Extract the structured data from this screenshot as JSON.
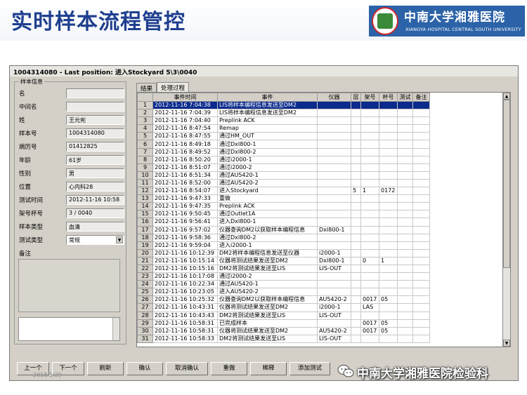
{
  "slide": {
    "title": "实时样本流程管控",
    "logo_cn": "中南大学湘雅医院",
    "logo_en": "XIANGYA HOSPITAL CENTRAL SOUTH UNIVERSITY"
  },
  "window": {
    "title": "1004314080 - Last position: 进入Stockyard  5\\3\\0040"
  },
  "sample_info": {
    "legend": "样本信息",
    "fields": [
      {
        "label": "名",
        "value": ""
      },
      {
        "label": "中间名",
        "value": ""
      },
      {
        "label": "姓",
        "value": "王元宪"
      },
      {
        "label": "样本号",
        "value": "1004314080"
      },
      {
        "label": "病历号",
        "value": "01412825"
      },
      {
        "label": "年龄",
        "value": "61岁"
      },
      {
        "label": "性别",
        "value": "男"
      },
      {
        "label": "位置",
        "value": "心内科28"
      },
      {
        "label": "测试时间",
        "value": "2012-11-16 10:58"
      },
      {
        "label": "架号杯号",
        "value": "3 / 0040"
      },
      {
        "label": "样本类型",
        "value": "血清"
      },
      {
        "label": "测试类型",
        "value": "常规"
      }
    ],
    "remark_label": "备注"
  },
  "tabs": [
    {
      "label": "结果",
      "active": false
    },
    {
      "label": "处理过程",
      "active": true
    }
  ],
  "grid": {
    "columns": [
      "",
      "事件时间",
      "事件",
      "仪器",
      "层",
      "架号",
      "杯号",
      "测试",
      "备注"
    ],
    "selected_row": 0,
    "rows": [
      [
        "1",
        "2012-11-16 7:04:38",
        "LIS将样本编程信息发送至DM2",
        "",
        "",
        "",
        "",
        "",
        ""
      ],
      [
        "2",
        "2012-11-16 7:04:39",
        "LIS将样本编程信息发送至DM2",
        "",
        "",
        "",
        "",
        "",
        ""
      ],
      [
        "3",
        "2012-11-16 7:04:40",
        "Preplink ACK",
        "",
        "",
        "",
        "",
        "",
        ""
      ],
      [
        "4",
        "2012-11-16 8:47:54",
        "Remap",
        "",
        "",
        "",
        "",
        "",
        ""
      ],
      [
        "5",
        "2012-11-16 8:47:55",
        "通过HM_OUT",
        "",
        "",
        "",
        "",
        "",
        ""
      ],
      [
        "6",
        "2012-11-16 8:49:18",
        "通过DxI800-1",
        "",
        "",
        "",
        "",
        "",
        ""
      ],
      [
        "7",
        "2012-11-16 8:49:52",
        "通过DxI800-2",
        "",
        "",
        "",
        "",
        "",
        ""
      ],
      [
        "8",
        "2012-11-16 8:50:20",
        "通过i2000-1",
        "",
        "",
        "",
        "",
        "",
        ""
      ],
      [
        "9",
        "2012-11-16 8:51:07",
        "通过i2000-2",
        "",
        "",
        "",
        "",
        "",
        ""
      ],
      [
        "10",
        "2012-11-16 8:51:34",
        "通过AU5420-1",
        "",
        "",
        "",
        "",
        "",
        ""
      ],
      [
        "11",
        "2012-11-16 8:52:00",
        "通过AU5420-2",
        "",
        "",
        "",
        "",
        "",
        ""
      ],
      [
        "12",
        "2012-11-16 8:54:07",
        "进入Stockyard",
        "",
        "5",
        "1",
        "0172",
        "",
        ""
      ],
      [
        "13",
        "2012-11-16 9:47:33",
        "重做",
        "",
        "",
        "",
        "",
        "",
        ""
      ],
      [
        "14",
        "2012-11-16 9:47:35",
        "Preplink ACK",
        "",
        "",
        "",
        "",
        "",
        ""
      ],
      [
        "15",
        "2012-11-16 9:50:45",
        "通过Outlet1A",
        "",
        "",
        "",
        "",
        "",
        ""
      ],
      [
        "16",
        "2012-11-16 9:56:41",
        "进入DxI800-1",
        "",
        "",
        "",
        "",
        "",
        ""
      ],
      [
        "17",
        "2012-11-16 9:57:02",
        "仪器查询DM2以获取样本编程信息",
        "DxI800-1",
        "",
        "",
        "",
        "",
        ""
      ],
      [
        "18",
        "2012-11-16 9:58:36",
        "通过DxI800-2",
        "",
        "",
        "",
        "",
        "",
        ""
      ],
      [
        "19",
        "2012-11-16 9:59:04",
        "进入i2000-1",
        "",
        "",
        "",
        "",
        "",
        ""
      ],
      [
        "20",
        "2012-11-16 10:12:39",
        "DM2将样本编程信息发送至仪器",
        "i2000-1",
        "",
        "",
        "",
        "",
        ""
      ],
      [
        "21",
        "2012-11-16 10:15:14",
        "仪器将测试结果发送至DM2",
        "DxI800-1",
        "",
        "0",
        "1",
        "",
        ""
      ],
      [
        "22",
        "2012-11-16 10:15:16",
        "DM2将测试结果发送至LIS",
        "LIS-OUT",
        "",
        "",
        "",
        "",
        ""
      ],
      [
        "23",
        "2012-11-16 10:17:08",
        "通过i2000-2",
        "",
        "",
        "",
        "",
        "",
        ""
      ],
      [
        "24",
        "2012-11-16 10:22:34",
        "通过AU5420-1",
        "",
        "",
        "",
        "",
        "",
        ""
      ],
      [
        "25",
        "2012-11-16 10:23:05",
        "进入AU5420-2",
        "",
        "",
        "",
        "",
        "",
        ""
      ],
      [
        "26",
        "2012-11-16 10:25:32",
        "仪器查询DM2以获取样本编程信息",
        "AU5420-2",
        "",
        "0017",
        "05",
        "",
        ""
      ],
      [
        "27",
        "2012-11-16 10:43:31",
        "仪器将测试结果发送至DM2",
        "i2000-1",
        "",
        "LAS",
        "",
        "",
        ""
      ],
      [
        "28",
        "2012-11-16 10:43:43",
        "DM2将测试结果发送至LIS",
        "LIS-OUT",
        "",
        "",
        "",
        "",
        ""
      ],
      [
        "29",
        "2012-11-16 10:58:31",
        "已完成样本",
        "",
        "",
        "0017",
        "05",
        "",
        ""
      ],
      [
        "30",
        "2012-11-16 10:58:31",
        "仪器将测试结果发送至DM2",
        "AU5420-2",
        "",
        "0017",
        "05",
        "",
        ""
      ],
      [
        "31",
        "2012-11-16 10:58:33",
        "DM2将测试结果发送至LIS",
        "LIS-OUT",
        "",
        "",
        "",
        "",
        ""
      ]
    ]
  },
  "buttons": [
    {
      "name": "prev-button",
      "label": "上一个"
    },
    {
      "name": "next-button",
      "label": "下一个"
    },
    {
      "name": "refresh-button",
      "label": "刷新"
    },
    {
      "name": "confirm-button",
      "label": "确认"
    },
    {
      "name": "cancel-confirm-button",
      "label": "取消确认"
    },
    {
      "name": "redo-button",
      "label": "重做"
    },
    {
      "name": "dilute-button",
      "label": "稀释"
    },
    {
      "name": "add-test-button",
      "label": "添加测试"
    }
  ],
  "date_stamp": "2018/5/29",
  "watermark": {
    "text": "中南大学湘雅医院检验科"
  }
}
